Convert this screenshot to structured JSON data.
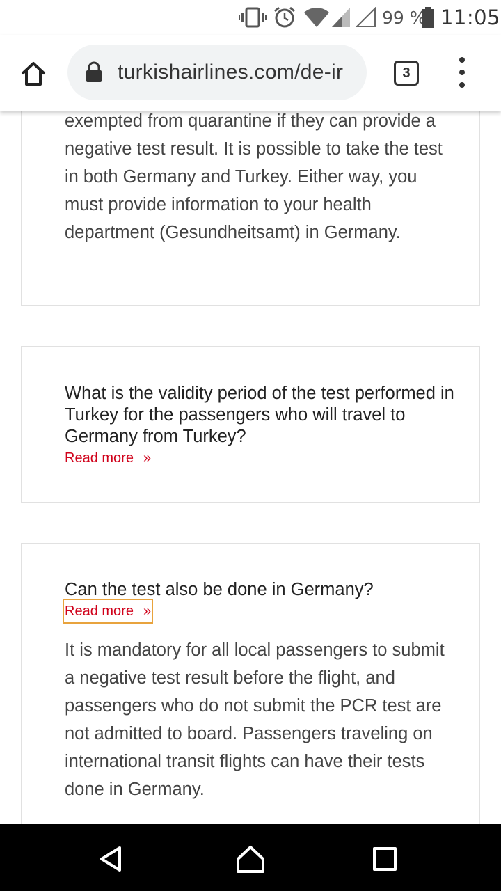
{
  "status_bar": {
    "battery": "99 %",
    "time": "11:05",
    "icons": [
      "vibrate-icon",
      "alarm-icon",
      "wifi-icon",
      "cell-signal-icon",
      "cell-signal-empty-icon",
      "battery-icon"
    ]
  },
  "browser": {
    "url": "turkishairlines.com/de-ir",
    "tab_count": "3",
    "icons": [
      "home-icon",
      "lock-icon",
      "more-vert-icon"
    ]
  },
  "cards": [
    {
      "body": "exempted from quarantine if they can provide a negative test result. It is possible to take the test in both Germany and Turkey. Either way, you must provide information to your health department (Gesundheitsamt) in Germany."
    },
    {
      "question": "What is the validity period of the test performed in Turkey for the passengers who will travel to Germany from Turkey?",
      "read_more": "Read more",
      "chevron": "»"
    },
    {
      "question": "Can the test also be done in Germany?",
      "read_more": "Read more",
      "chevron": "»",
      "body": "It is mandatory for all local passengers to submit a negative test result before the flight, and passengers who do not submit the PCR test are not admitted to board. Passengers traveling on international transit flights can have their tests done in Germany."
    }
  ],
  "colors": {
    "accent": "#d0021b",
    "focus_outline": "#e8a33d",
    "card_border": "#e1e1e1",
    "nav_bar": "#000000"
  },
  "nav_bar": {
    "icons": [
      "back-triangle-icon",
      "home-circle-icon",
      "recents-square-icon"
    ]
  }
}
